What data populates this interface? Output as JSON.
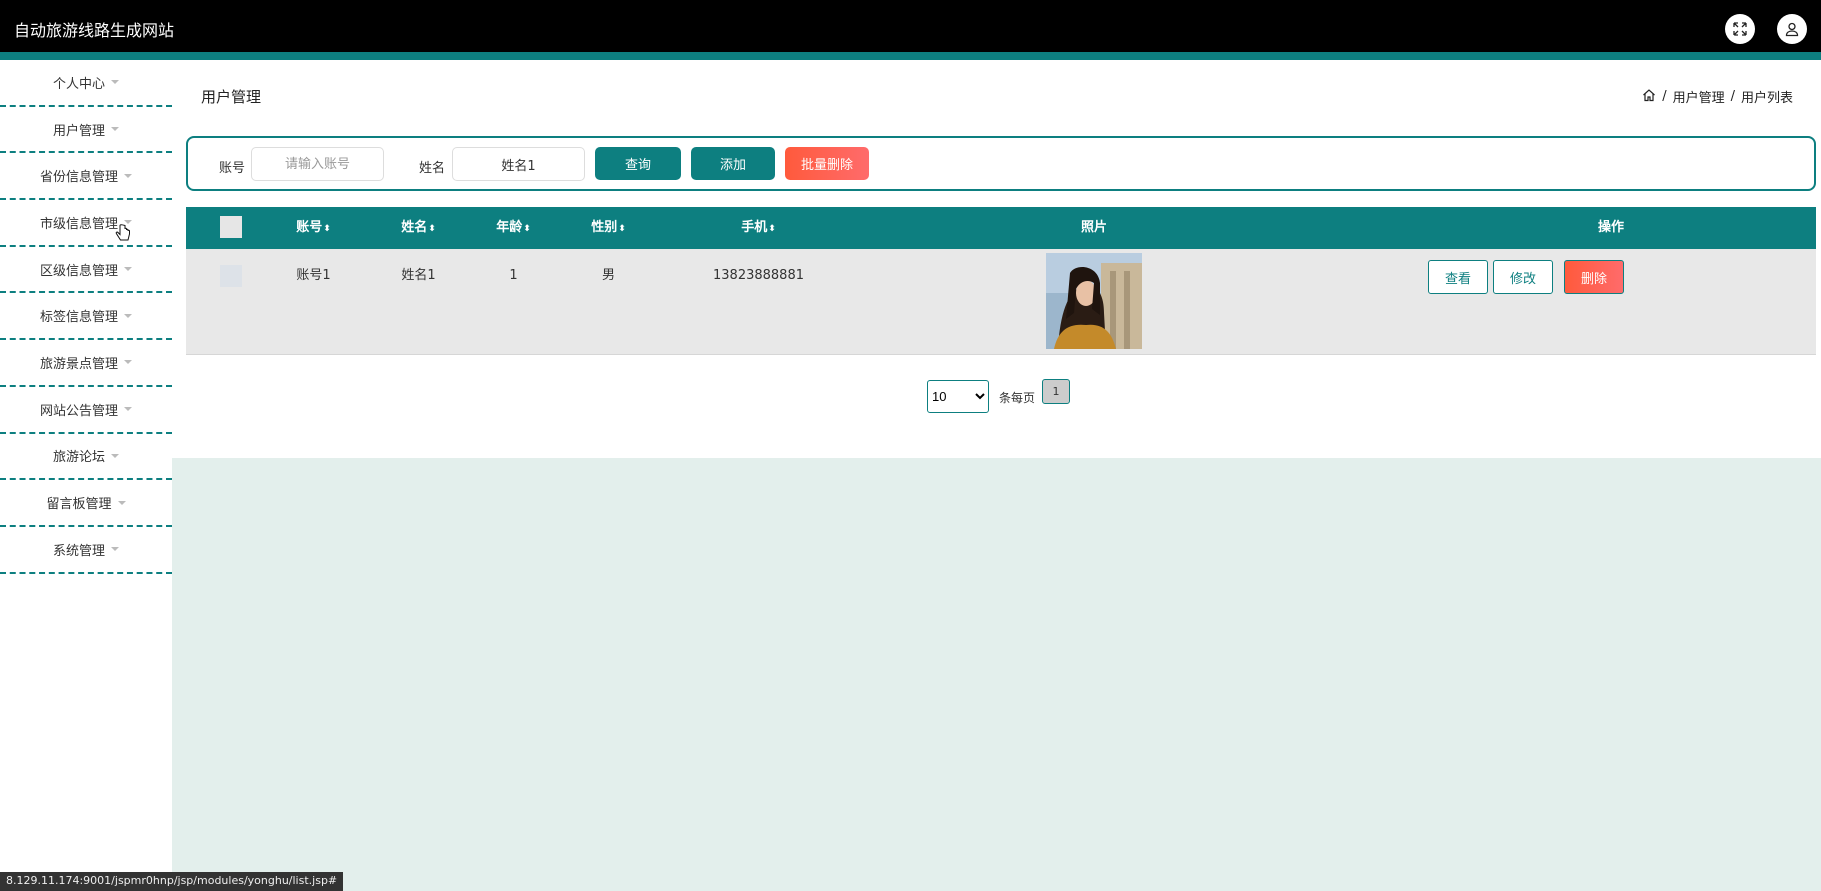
{
  "header": {
    "title": "自动旅游线路生成网站",
    "icons": [
      "fullscreen-icon",
      "user-icon"
    ]
  },
  "sidebar": {
    "items": [
      {
        "label": "个人中心"
      },
      {
        "label": "用户管理"
      },
      {
        "label": "省份信息管理"
      },
      {
        "label": "市级信息管理"
      },
      {
        "label": "区级信息管理"
      },
      {
        "label": "标签信息管理"
      },
      {
        "label": "旅游景点管理"
      },
      {
        "label": "网站公告管理"
      },
      {
        "label": "旅游论坛"
      },
      {
        "label": "留言板管理"
      },
      {
        "label": "系统管理"
      }
    ]
  },
  "page": {
    "title": "用户管理"
  },
  "breadcrumb": {
    "sep": "/",
    "level1": "用户管理",
    "level2": "用户列表"
  },
  "search": {
    "account_label": "账号",
    "account_placeholder": "请输入账号",
    "name_label": "姓名",
    "name_value": "姓名1",
    "query_button": "查询",
    "add_button": "添加",
    "batch_delete_button": "批量删除"
  },
  "table": {
    "columns": [
      "账号",
      "姓名",
      "年龄",
      "性别",
      "手机",
      "照片",
      "操作"
    ],
    "sort_glyph": "⬍",
    "rows": [
      {
        "account": "账号1",
        "name": "姓名1",
        "age": "1",
        "gender": "男",
        "phone": "13823888881"
      }
    ],
    "actions": {
      "view": "查看",
      "edit": "修改",
      "delete": "删除"
    }
  },
  "pagination": {
    "page_size": "10",
    "per_page_label": "条每页",
    "current_page": "1"
  },
  "status_bar": {
    "url": "8.129.11.174:9001/jspmr0hnp/jsp/modules/yonghu/list.jsp#"
  },
  "colors": {
    "primary": "#0d7f80",
    "danger_start": "#ff5a3c",
    "danger_end": "#ff6b6b",
    "content_bg": "#e3efec"
  }
}
